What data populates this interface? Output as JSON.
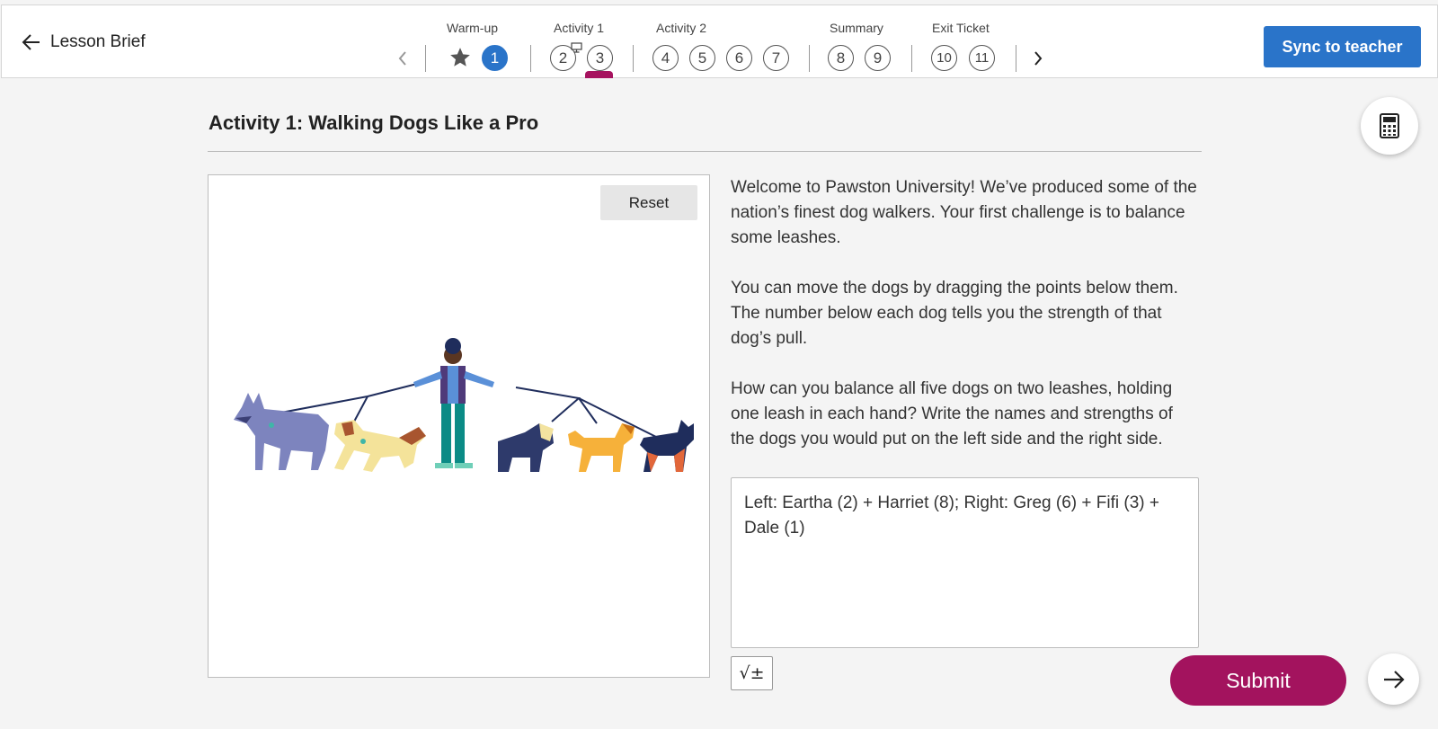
{
  "header": {
    "back_label": "Lesson Brief",
    "sections": [
      {
        "label": "Warm-up"
      },
      {
        "label": "Activity 1"
      },
      {
        "label": "Activity 2"
      },
      {
        "label": "Summary"
      },
      {
        "label": "Exit Ticket"
      }
    ],
    "screens": [
      "1",
      "2",
      "3",
      "4",
      "5",
      "6",
      "7",
      "8",
      "9",
      "10",
      "11"
    ],
    "active_screen": "1",
    "current_screen": "3",
    "sync_label": "Sync to teacher"
  },
  "activity": {
    "title": "Activity 1: Walking Dogs Like a Pro",
    "reset_label": "Reset",
    "prompt": [
      "Welcome to Pawston University! We’ve produced some of the nation’s finest dog walkers. Your first challenge is to balance some leashes.",
      "You can move the dogs by dragging the points below them. The number below each dog tells you the strength of that dog’s pull.",
      "How can you balance all five dogs on two leashes, holding one leash in each hand? Write the names and strengths of the dogs you would put on the left side and the right side."
    ],
    "response_value": "Left: Eartha (2) + Harriet (8); Right: Greg (6) + Fifi (3) + Dale (1)",
    "math_button_label": "√±",
    "submit_label": "Submit"
  },
  "icons": {
    "back": "arrow-left-icon",
    "prev": "chevron-left-icon",
    "next_screen": "chevron-right-icon",
    "warmup": "star-icon",
    "calculator": "calculator-icon",
    "next_page": "arrow-right-icon",
    "presenting": "presentation-screen-icon"
  },
  "colors": {
    "accent_blue": "#2a74c9",
    "submit_magenta": "#a3135e"
  }
}
